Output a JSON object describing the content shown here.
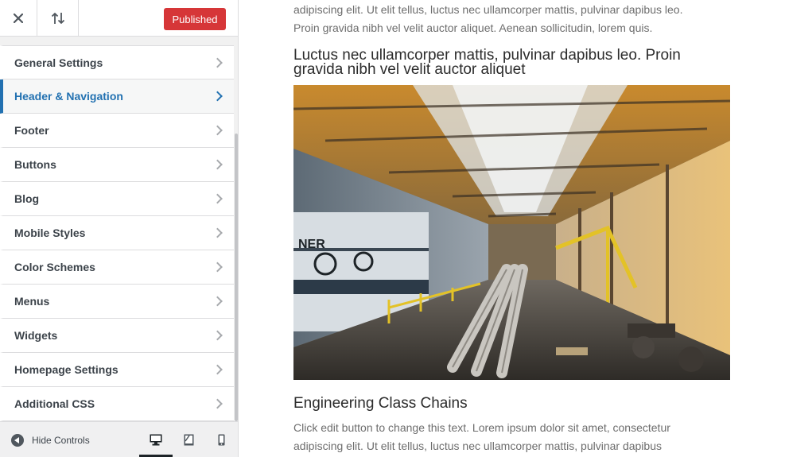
{
  "topbar": {
    "close_icon": "close-icon",
    "reorder_icon": "reorder-arrows-icon",
    "publish_label": "Published"
  },
  "sections": [
    {
      "label": "General Settings",
      "active": false
    },
    {
      "label": "Header & Navigation",
      "active": true
    },
    {
      "label": "Footer",
      "active": false
    },
    {
      "label": "Buttons",
      "active": false
    },
    {
      "label": "Blog",
      "active": false
    },
    {
      "label": "Mobile Styles",
      "active": false
    },
    {
      "label": "Color Schemes",
      "active": false
    },
    {
      "label": "Menus",
      "active": false
    },
    {
      "label": "Widgets",
      "active": false
    },
    {
      "label": "Homepage Settings",
      "active": false
    },
    {
      "label": "Additional CSS",
      "active": false
    }
  ],
  "footer": {
    "hide_controls_label": "Hide Controls",
    "devices": [
      "desktop-icon",
      "tablet-icon",
      "mobile-icon"
    ],
    "active_device": "desktop"
  },
  "preview": {
    "paragraph_top": "adipiscing elit. Ut elit tellus, luctus nec ullamcorper mattis, pulvinar dapibus leo. Proin gravida nibh vel velit auctor aliquet. Aenean sollicitudin, lorem quis.",
    "heading_1": "Luctus nec ullamcorper mattis, pulvinar dapibus leo. Proin gravida nibh vel velit auctor aliquet",
    "image_subject": "factory-interior-image",
    "heading_2": "Engineering Class Chains",
    "paragraph_bottom": "Click edit button to change this text. Lorem ipsum dolor sit amet, consectetur adipiscing elit. Ut elit tellus, luctus nec ullamcorper mattis, pulvinar dapibus"
  },
  "colors": {
    "publish": "#d63638",
    "accent": "#2271b1",
    "sidebar_bg": "#f1f1f1"
  }
}
